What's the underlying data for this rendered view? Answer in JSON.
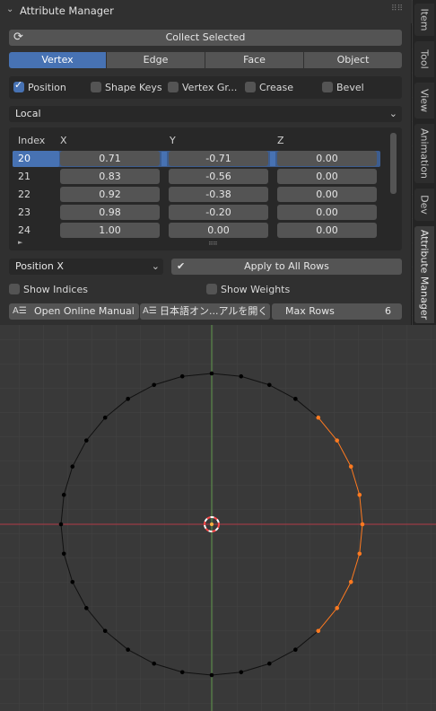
{
  "panel": {
    "title": "Attribute Manager",
    "collect_label": "Collect Selected",
    "modes": [
      "Vertex",
      "Edge",
      "Face",
      "Object"
    ],
    "active_mode": "Vertex",
    "attributes": [
      {
        "label": "Position",
        "checked": true
      },
      {
        "label": "Shape Keys",
        "checked": false
      },
      {
        "label": "Vertex Gr...",
        "checked": false
      },
      {
        "label": "Crease",
        "checked": false
      },
      {
        "label": "Bevel",
        "checked": false
      }
    ],
    "space": "Local",
    "table": {
      "headers": [
        "Index",
        "X",
        "Y",
        "Z"
      ],
      "rows": [
        {
          "index": "20",
          "x": "0.71",
          "y": "-0.71",
          "z": "0.00"
        },
        {
          "index": "21",
          "x": "0.83",
          "y": "-0.56",
          "z": "0.00"
        },
        {
          "index": "22",
          "x": "0.92",
          "y": "-0.38",
          "z": "0.00"
        },
        {
          "index": "23",
          "x": "0.98",
          "y": "-0.20",
          "z": "0.00"
        },
        {
          "index": "24",
          "x": "1.00",
          "y": "0.00",
          "z": "0.00"
        }
      ],
      "active_row": "20"
    },
    "target": "Position X",
    "apply_label": "Apply to All Rows",
    "show_indices": "Show Indices",
    "show_weights": "Show Weights",
    "manual_en": "Open Online Manual",
    "manual_ja": "日本語オン...アルを開く",
    "max_rows_label": "Max Rows",
    "max_rows_value": "6"
  },
  "tabs": [
    "Item",
    "Tool",
    "View",
    "Animation",
    "Dev",
    "Attribute Manager"
  ],
  "active_tab": "Attribute Manager",
  "colors": {
    "accent": "#4772b3",
    "selected_vertex": "#ff7a20",
    "x_axis": "#c0404a",
    "y_axis": "#6aa84f"
  }
}
